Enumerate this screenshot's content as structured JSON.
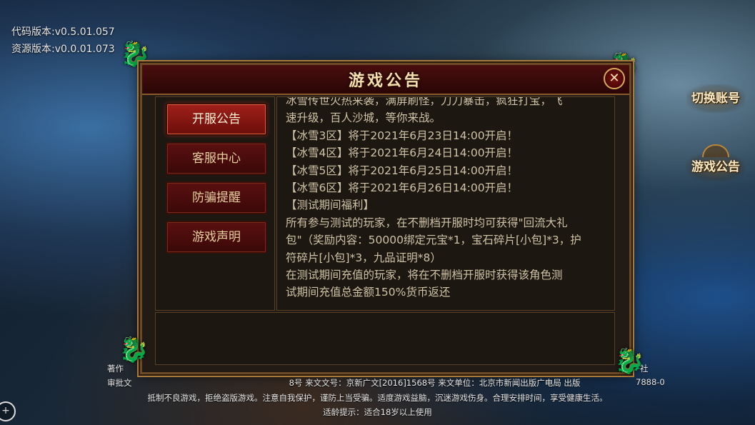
{
  "version": {
    "code": "代码版本:v0.5.01.057",
    "resource": "资源版本:v0.0.01.073"
  },
  "side_buttons": {
    "switch_account": "切换账号",
    "announcement": "游戏公告"
  },
  "dialog": {
    "title": "游戏公告",
    "close_icon": "✕",
    "tabs": [
      {
        "label": "开服公告",
        "active": true
      },
      {
        "label": "客服中心",
        "active": false
      },
      {
        "label": "防骗提醒",
        "active": false
      },
      {
        "label": "游戏声明",
        "active": false
      }
    ],
    "content_lines": [
      "冰雪传世火热来袭，满屏刷怪，刀刀暴击，疯狂打宝，飞",
      "速升级，百人沙城，等你来战。",
      "【冰雪3区】将于2021年6月23日14:00开启！",
      "【冰雪4区】将于2021年6月24日14:00开启！",
      "【冰雪5区】将于2021年6月25日14:00开启！",
      "【冰雪6区】将于2021年6月26日14:00开启！",
      "【测试期间福利】",
      "所有参与测试的玩家，在不删档开服时均可获得\"回流大礼",
      "包\"（奖励内容：50000绑定元宝*1，宝石碎片[小包]*3，护",
      "符碎片[小包]*3，九品证明*8）",
      "在测试期间充值的玩家，将在不删档开服时获得该角色测",
      "试期间充值总金额150%货币返还"
    ]
  },
  "footer": {
    "left_fragment": "著作",
    "approval_left": "审批文",
    "line1_center": "8号 来文文号：京新广文[2016]1568号 来文单位：北京市新闻出版广电局 出版",
    "line1_right": "7888-0",
    "line1_right_top": "社",
    "line2": "抵制不良游戏，拒绝盗版游戏。注意自我保护，谨防上当受骗。适度游戏益脑，沉迷游戏伤身。合理安排时间，享受健康生活。",
    "line3": "适龄提示：适合18岁以上使用"
  },
  "icons": {
    "corner": "plus-icon"
  },
  "colors": {
    "title_gold": "#f3dfb0",
    "tab_active_red": "#a0201a",
    "text": "#cfc2a6"
  }
}
